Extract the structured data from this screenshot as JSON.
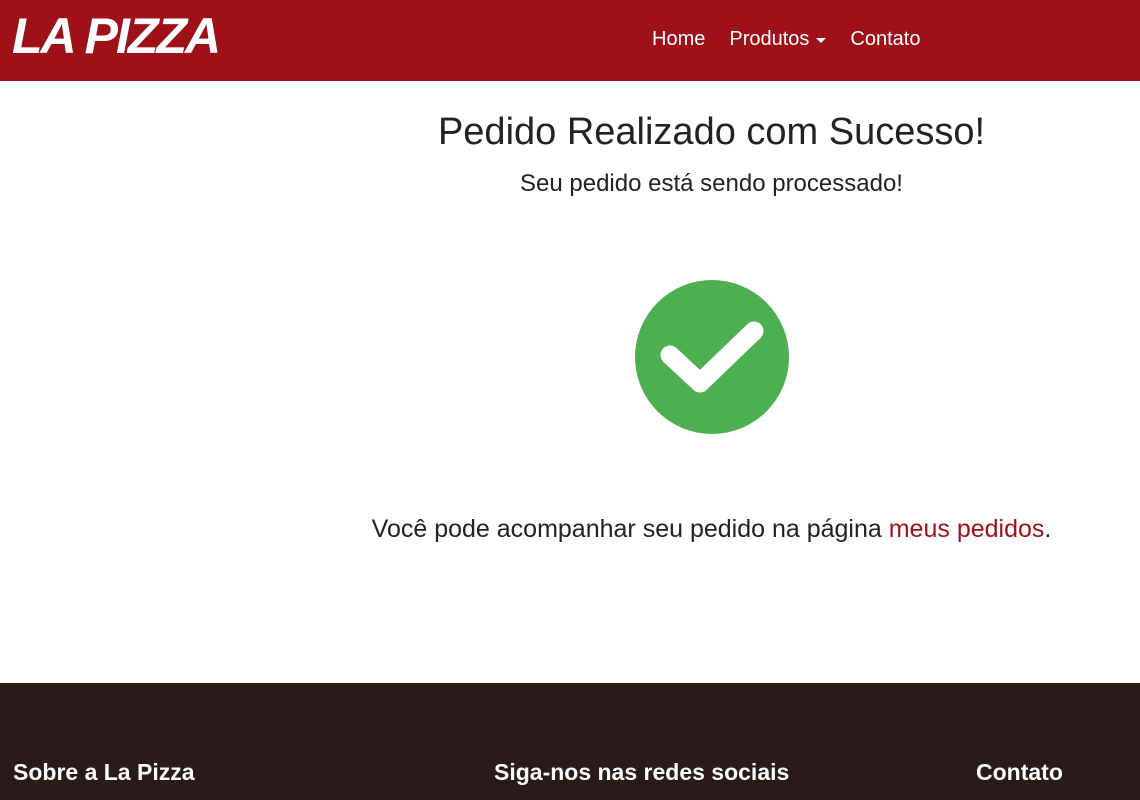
{
  "navbar": {
    "brand": "LA PIZZA",
    "links": [
      {
        "label": "Home"
      },
      {
        "label": "Produtos"
      },
      {
        "label": "Contato"
      }
    ]
  },
  "main": {
    "title": "Pedido Realizado com Sucesso!",
    "subtitle": "Seu pedido está sendo processado!",
    "success_icon": "check-circle-icon",
    "note_prefix": "Você pode acompanhar seu pedido na página ",
    "note_link": "meus pedidos",
    "note_suffix": "."
  },
  "footer": {
    "about_heading": "Sobre a La Pizza",
    "social_heading": "Siga-nos nas redes sociais",
    "contact_heading": "Contato"
  },
  "colors": {
    "brand": "#9e1119",
    "success": "#4caf50",
    "footer_bg": "#2a1a1a"
  }
}
